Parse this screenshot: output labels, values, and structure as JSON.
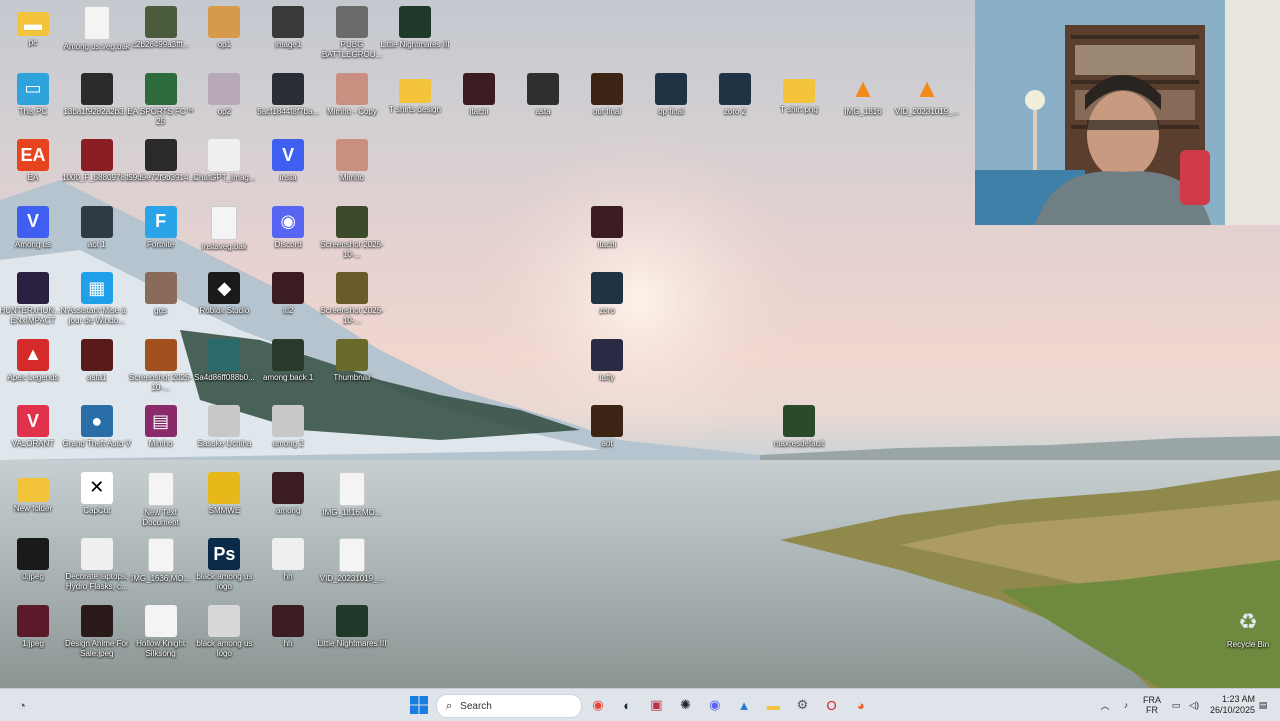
{
  "desktop": {
    "icons": [
      {
        "label": "pc",
        "icon": "folder-icon",
        "color": "#f3c33a",
        "glyph": "▬",
        "col": 0,
        "row": 0
      },
      {
        "label": "Among us.veg.bak",
        "icon": "file-icon",
        "color": "#f4f4f4",
        "glyph": "",
        "col": 1,
        "row": 0
      },
      {
        "label": "c2b26499a3fff...",
        "icon": "image-icon",
        "color": "#4b5c3c",
        "glyph": "",
        "col": 2,
        "row": 0
      },
      {
        "label": "op1",
        "icon": "image-icon",
        "color": "#d79a4a",
        "glyph": "",
        "col": 3,
        "row": 0
      },
      {
        "label": "image1",
        "icon": "image-icon",
        "color": "#3a3a3a",
        "glyph": "",
        "col": 4,
        "row": 0
      },
      {
        "label": "PUBG BATTLEGROU...",
        "icon": "pubg-icon",
        "color": "#6b6b6b",
        "glyph": "",
        "col": 5,
        "row": 0
      },
      {
        "label": "Little Nightmares III",
        "icon": "game-icon",
        "color": "#1f3a2a",
        "glyph": "",
        "col": 6,
        "row": 0
      },
      {
        "label": "This PC",
        "icon": "computer-icon",
        "color": "#2fa4dc",
        "glyph": "▭",
        "col": 0,
        "row": 1
      },
      {
        "label": "13ba1f9282a2b3...",
        "icon": "image-icon",
        "color": "#2b2b2b",
        "glyph": "",
        "col": 1,
        "row": 1
      },
      {
        "label": "EA SPORTS FC™ 25",
        "icon": "game-icon",
        "color": "#2d6a3c",
        "glyph": "",
        "col": 2,
        "row": 1
      },
      {
        "label": "op2",
        "icon": "image-icon",
        "color": "#b7a9b8",
        "glyph": "",
        "col": 3,
        "row": 1
      },
      {
        "label": "5acf1844f8f7ba...",
        "icon": "image-icon",
        "color": "#2a2d33",
        "glyph": "",
        "col": 4,
        "row": 1
      },
      {
        "label": "Mimho - Copy",
        "icon": "image-icon",
        "color": "#c98f80",
        "glyph": "",
        "col": 5,
        "row": 1
      },
      {
        "label": "T shirts design",
        "icon": "folder-icon",
        "color": "#f3c33a",
        "glyph": "",
        "col": 6,
        "row": 1
      },
      {
        "label": "itachi",
        "icon": "image-icon",
        "color": "#3a1c22",
        "glyph": "",
        "col": 7,
        "row": 1
      },
      {
        "label": "asta",
        "icon": "image-icon",
        "color": "#2f2f2f",
        "glyph": "",
        "col": 8,
        "row": 1
      },
      {
        "label": "out final",
        "icon": "image-icon",
        "color": "#3b2414",
        "glyph": "",
        "col": 9,
        "row": 1
      },
      {
        "label": "op final",
        "icon": "image-icon",
        "color": "#1f3344",
        "glyph": "",
        "col": 10,
        "row": 1
      },
      {
        "label": "zoro 2",
        "icon": "image-icon",
        "color": "#1f3344",
        "glyph": "",
        "col": 11,
        "row": 1
      },
      {
        "label": "T shirt png",
        "icon": "folder-icon",
        "color": "#f3c33a",
        "glyph": "",
        "col": 12,
        "row": 1
      },
      {
        "label": "IMG_1816",
        "icon": "vlc-icon",
        "color": "#f08a1c",
        "glyph": "▲",
        "col": 13,
        "row": 1
      },
      {
        "label": "VID_20231019_...",
        "icon": "vlc-icon",
        "color": "#f08a1c",
        "glyph": "▲",
        "col": 14,
        "row": 1
      },
      {
        "label": "EA",
        "icon": "ea-icon",
        "color": "#e8431f",
        "glyph": "EA",
        "col": 0,
        "row": 2
      },
      {
        "label": "1000_F_5880978...",
        "icon": "image-icon",
        "color": "#8a1c24",
        "glyph": "",
        "col": 1,
        "row": 2
      },
      {
        "label": "f59d9e72f9b3914...",
        "icon": "image-icon",
        "color": "#2a2a2a",
        "glyph": "",
        "col": 2,
        "row": 2
      },
      {
        "label": "ChatGPT_Imag...",
        "icon": "image-icon",
        "color": "#efefef",
        "glyph": "",
        "col": 3,
        "row": 2
      },
      {
        "label": "insta",
        "icon": "vpn-icon",
        "color": "#3f5ff0",
        "glyph": "V",
        "col": 4,
        "row": 2
      },
      {
        "label": "Mimho",
        "icon": "image-icon",
        "color": "#c98f80",
        "glyph": "",
        "col": 5,
        "row": 2
      },
      {
        "label": "Among us",
        "icon": "vpn-icon",
        "color": "#3f5ff0",
        "glyph": "V",
        "col": 0,
        "row": 3
      },
      {
        "label": "aot 1",
        "icon": "image-icon",
        "color": "#2f3a45",
        "glyph": "",
        "col": 1,
        "row": 3
      },
      {
        "label": "Fortnite",
        "icon": "fortnite-icon",
        "color": "#29a4e8",
        "glyph": "F",
        "col": 2,
        "row": 3
      },
      {
        "label": "instaveg.bak",
        "icon": "file-icon",
        "color": "#f4f4f4",
        "glyph": "",
        "col": 3,
        "row": 3
      },
      {
        "label": "Discord",
        "icon": "discord-icon",
        "color": "#5865f2",
        "glyph": "◉",
        "col": 4,
        "row": 3
      },
      {
        "label": "Screenshot 2025-10-...",
        "icon": "image-icon",
        "color": "#3c4a2c",
        "glyph": "",
        "col": 5,
        "row": 3
      },
      {
        "label": "itachi",
        "icon": "image-icon",
        "color": "#3a1c22",
        "glyph": "",
        "col": 9,
        "row": 3
      },
      {
        "label": "HUNTERxHUN...NENxIMPACT",
        "icon": "game-icon",
        "color": "#2a2040",
        "glyph": "",
        "col": 0,
        "row": 4
      },
      {
        "label": "Assistant Mise à jour de Windo...",
        "icon": "windows-icon",
        "color": "#1fa0e8",
        "glyph": "▦",
        "col": 1,
        "row": 4
      },
      {
        "label": "ggs",
        "icon": "image-icon",
        "color": "#8a6a5a",
        "glyph": "",
        "col": 2,
        "row": 4
      },
      {
        "label": "Roblox Studio",
        "icon": "roblox-icon",
        "color": "#1a1a1a",
        "glyph": "◆",
        "col": 3,
        "row": 4
      },
      {
        "label": "iti2",
        "icon": "image-icon",
        "color": "#3a1c22",
        "glyph": "",
        "col": 4,
        "row": 4
      },
      {
        "label": "Screenshot 2025-10-...",
        "icon": "image-icon",
        "color": "#6a5a2a",
        "glyph": "",
        "col": 5,
        "row": 4
      },
      {
        "label": "zoro",
        "icon": "image-icon",
        "color": "#1f3344",
        "glyph": "",
        "col": 9,
        "row": 4
      },
      {
        "label": "Apex Legends",
        "icon": "apex-icon",
        "color": "#d42a2a",
        "glyph": "▲",
        "col": 0,
        "row": 5
      },
      {
        "label": "asta1",
        "icon": "image-icon",
        "color": "#5a1a1a",
        "glyph": "",
        "col": 1,
        "row": 5
      },
      {
        "label": "Screenshot 2025-10-...",
        "icon": "image-icon",
        "color": "#a3501f",
        "glyph": "",
        "col": 2,
        "row": 5
      },
      {
        "label": "Sa4d86ff088b0...",
        "icon": "image-icon",
        "color": "#2a6a6a",
        "glyph": "",
        "col": 3,
        "row": 5
      },
      {
        "label": "among back 1",
        "icon": "image-icon",
        "color": "#2a3a2a",
        "glyph": "",
        "col": 4,
        "row": 5
      },
      {
        "label": "Thumbnail",
        "icon": "image-icon",
        "color": "#6a6a2a",
        "glyph": "",
        "col": 5,
        "row": 5
      },
      {
        "label": "luffy",
        "icon": "image-icon",
        "color": "#2a2a44",
        "glyph": "",
        "col": 9,
        "row": 5
      },
      {
        "label": "VALORANT",
        "icon": "valorant-icon",
        "color": "#e0324a",
        "glyph": "V",
        "col": 0,
        "row": 6
      },
      {
        "label": "Grand Theft Auto V",
        "icon": "gta-icon",
        "color": "#2a6ea8",
        "glyph": "●",
        "col": 1,
        "row": 6
      },
      {
        "label": "Mimho",
        "icon": "winrar-icon",
        "color": "#8a2a6a",
        "glyph": "▤",
        "col": 2,
        "row": 6
      },
      {
        "label": "Sasuke Uchiha",
        "icon": "image-icon",
        "color": "#c8c8c8",
        "glyph": "",
        "col": 3,
        "row": 6
      },
      {
        "label": "among 2",
        "icon": "image-icon",
        "color": "#c8c8c8",
        "glyph": "",
        "col": 4,
        "row": 6
      },
      {
        "label": "aot",
        "icon": "image-icon",
        "color": "#3b2414",
        "glyph": "",
        "col": 9,
        "row": 6
      },
      {
        "label": "maxresdefault",
        "icon": "image-icon",
        "color": "#2a4a2a",
        "glyph": "",
        "col": 12,
        "row": 6
      },
      {
        "label": "New folder",
        "icon": "folder-icon",
        "color": "#f3c33a",
        "glyph": "",
        "col": 0,
        "row": 7
      },
      {
        "label": "CapCut",
        "icon": "capcut-icon",
        "color": "#ffffff",
        "glyph": "✕",
        "col": 1,
        "row": 7
      },
      {
        "label": "New Text Document",
        "icon": "file-icon",
        "color": "#f4f4f4",
        "glyph": "",
        "col": 2,
        "row": 7
      },
      {
        "label": "SMMWE",
        "icon": "game-icon",
        "color": "#e8b81a",
        "glyph": "",
        "col": 3,
        "row": 7
      },
      {
        "label": "among",
        "icon": "image-icon",
        "color": "#3a1c22",
        "glyph": "",
        "col": 4,
        "row": 7
      },
      {
        "label": "IMG_1816.MO...",
        "icon": "file-icon",
        "color": "#f4f4f4",
        "glyph": "",
        "col": 5,
        "row": 7
      },
      {
        "label": "0.jpeg",
        "icon": "image-icon",
        "color": "#1a1a1a",
        "glyph": "",
        "col": 0,
        "row": 8
      },
      {
        "label": "Decorate laptops, Hydro Flasks, c...",
        "icon": "image-icon",
        "color": "#efefef",
        "glyph": "",
        "col": 1,
        "row": 8
      },
      {
        "label": "IMG_1636.MO...",
        "icon": "file-icon",
        "color": "#f4f4f4",
        "glyph": "",
        "col": 2,
        "row": 8
      },
      {
        "label": "black among us logo",
        "icon": "photoshop-icon",
        "color": "#0a2a4a",
        "glyph": "Ps",
        "col": 3,
        "row": 8
      },
      {
        "label": "hh",
        "icon": "image-icon",
        "color": "#efefef",
        "glyph": "",
        "col": 4,
        "row": 8
      },
      {
        "label": "VID_20231019_...",
        "icon": "file-icon",
        "color": "#f4f4f4",
        "glyph": "",
        "col": 5,
        "row": 8
      },
      {
        "label": "1.jpeg",
        "icon": "image-icon",
        "color": "#5a1a2a",
        "glyph": "",
        "col": 0,
        "row": 9
      },
      {
        "label": "Design Anime For Sale.jpeg",
        "icon": "image-icon",
        "color": "#2a1a1a",
        "glyph": "",
        "col": 1,
        "row": 9
      },
      {
        "label": "Hollow Knight Silksong",
        "icon": "game-icon",
        "color": "#f4f4f4",
        "glyph": "",
        "col": 2,
        "row": 9
      },
      {
        "label": "black among us logo",
        "icon": "image-icon",
        "color": "#d8d8d8",
        "glyph": "",
        "col": 3,
        "row": 9
      },
      {
        "label": "hh",
        "icon": "image-icon",
        "color": "#3a1c22",
        "glyph": "",
        "col": 4,
        "row": 9
      },
      {
        "label": "Little Nightmares III",
        "icon": "game-icon",
        "color": "#1f3a2a",
        "glyph": "",
        "col": 5,
        "row": 9
      }
    ],
    "recycle_bin": {
      "label": "Recycle Bin"
    }
  },
  "taskbar": {
    "search_placeholder": "Search",
    "apps": [
      {
        "name": "chrome-icon",
        "color": "#ea4335",
        "glyph": "◉"
      },
      {
        "name": "steam-icon",
        "color": "#1b2838",
        "glyph": "◐"
      },
      {
        "name": "app-icon",
        "color": "#c0304a",
        "glyph": "▣"
      },
      {
        "name": "chatgpt-icon",
        "color": "#222222",
        "glyph": "✺"
      },
      {
        "name": "discord-icon",
        "color": "#5865f2",
        "glyph": "◉"
      },
      {
        "name": "photos-icon",
        "color": "#2a7ad8",
        "glyph": "▲"
      },
      {
        "name": "file-explorer-icon",
        "color": "#f3c33a",
        "glyph": "▬"
      },
      {
        "name": "settings-icon",
        "color": "#555555",
        "glyph": "⚙"
      },
      {
        "name": "opera-icon",
        "color": "#e01a2a",
        "glyph": "O"
      },
      {
        "name": "firefox-icon",
        "color": "#e8601a",
        "glyph": "◕"
      }
    ],
    "tray": {
      "language_top": "FRA",
      "language_bottom": "FR",
      "time": "1:23 AM",
      "date": "26/10/2025"
    }
  }
}
